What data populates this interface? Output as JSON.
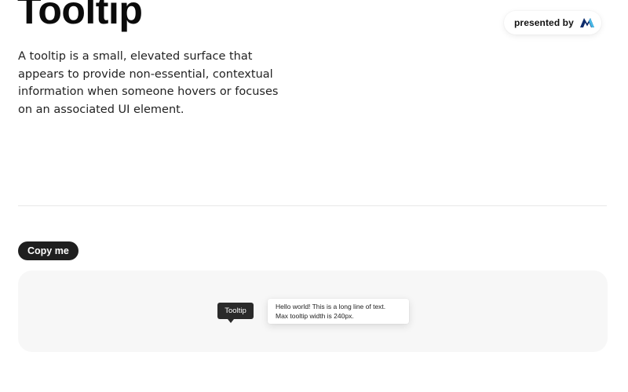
{
  "header": {
    "title": "Tooltip",
    "presented_by": "presented by",
    "brand_icon": "brand-logo-icon"
  },
  "intro": {
    "description": "A tooltip is a small, elevated surface that appears to provide non-essential, contextual information when someone hovers or focuses on an associated UI element."
  },
  "actions": {
    "copy_label": "Copy me"
  },
  "demo": {
    "dark_tooltip_text": "Tooltip",
    "light_tooltip_line1": "Hello world! This is a long line of text.",
    "light_tooltip_line2": "Max tooltip width is 240px."
  },
  "colors": {
    "brand_dark": "#0d2b6b",
    "brand_light": "#47b8e6",
    "button_bg": "#1f1f1f",
    "panel_bg": "#f7f7f7"
  }
}
